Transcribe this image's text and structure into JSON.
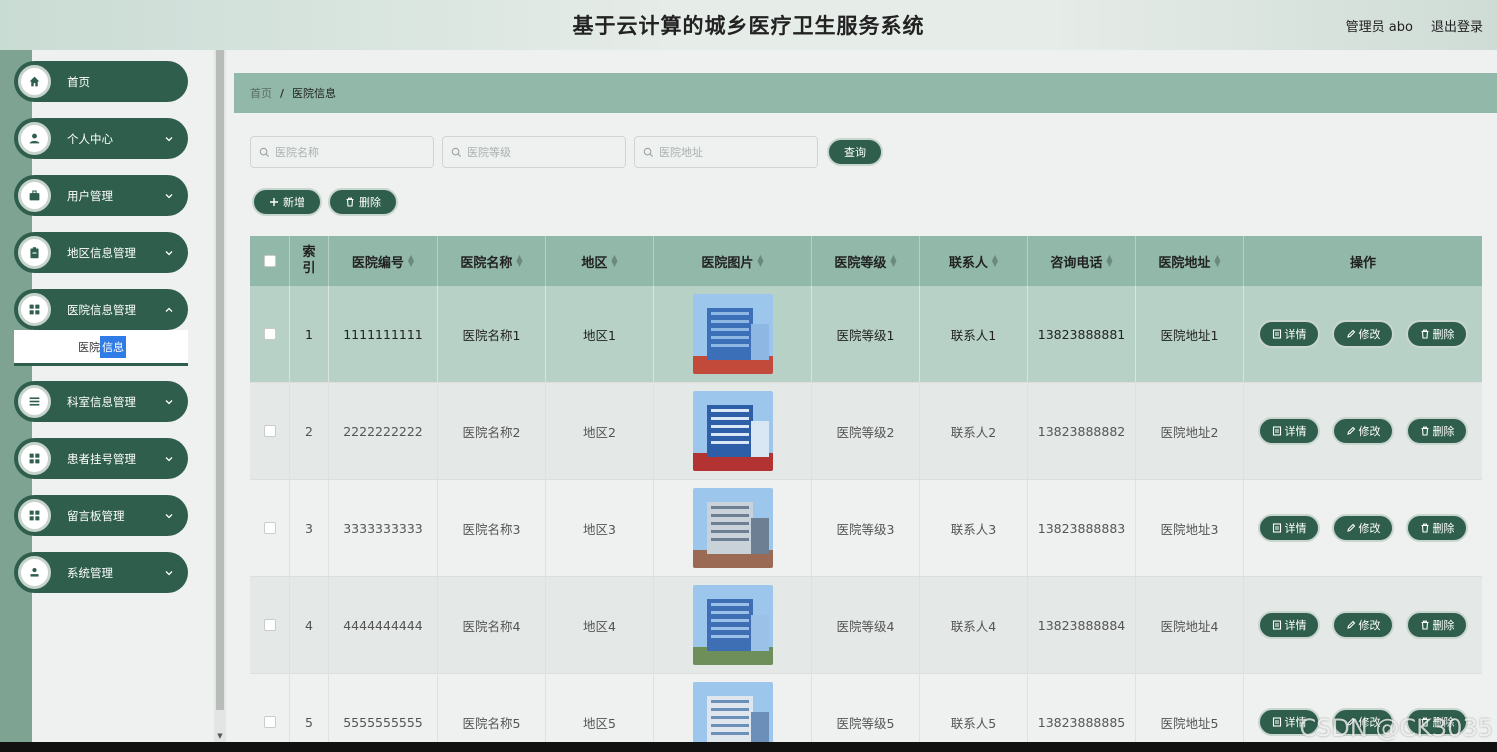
{
  "header": {
    "title": "基于云计算的城乡医疗卫生服务系统",
    "user": "管理员 abo",
    "logout": "退出登录"
  },
  "sidebar": {
    "items": [
      {
        "label": "首页",
        "icon": "home-icon",
        "chevron": false
      },
      {
        "label": "个人中心",
        "icon": "user-icon",
        "chevron": true
      },
      {
        "label": "用户管理",
        "icon": "briefcase-icon",
        "chevron": true
      },
      {
        "label": "地区信息管理",
        "icon": "clipboard-icon",
        "chevron": true
      },
      {
        "label": "医院信息管理",
        "icon": "grid-icon",
        "chevron": true
      },
      {
        "label": "科室信息管理",
        "icon": "list-icon",
        "chevron": true
      },
      {
        "label": "患者挂号管理",
        "icon": "grid-icon",
        "chevron": true
      },
      {
        "label": "留言板管理",
        "icon": "grid-icon",
        "chevron": true
      },
      {
        "label": "系统管理",
        "icon": "person-icon",
        "chevron": true
      }
    ],
    "sub_item": {
      "part1": "医院",
      "part2": "信息"
    }
  },
  "breadcrumb": {
    "home": "首页",
    "sep": "/",
    "current": "医院信息"
  },
  "search": {
    "name_placeholder": "医院名称",
    "level_placeholder": "医院等级",
    "address_placeholder": "医院地址",
    "query_label": "查询"
  },
  "actions": {
    "add_label": "新增",
    "delete_label": "删除"
  },
  "table": {
    "headers": {
      "index": "索引",
      "code": "医院编号",
      "name": "医院名称",
      "region": "地区",
      "image": "医院图片",
      "level": "医院等级",
      "contact": "联系人",
      "phone": "咨询电话",
      "address": "医院地址",
      "ops": "操作"
    },
    "rows": [
      {
        "index": "1",
        "code": "1111111111",
        "name": "医院名称1",
        "region": "地区1",
        "level": "医院等级1",
        "contact": "联系人1",
        "phone": "13823888881",
        "address": "医院地址1"
      },
      {
        "index": "2",
        "code": "2222222222",
        "name": "医院名称2",
        "region": "地区2",
        "level": "医院等级2",
        "contact": "联系人2",
        "phone": "13823888882",
        "address": "医院地址2"
      },
      {
        "index": "3",
        "code": "3333333333",
        "name": "医院名称3",
        "region": "地区3",
        "level": "医院等级3",
        "contact": "联系人3",
        "phone": "13823888883",
        "address": "医院地址3"
      },
      {
        "index": "4",
        "code": "4444444444",
        "name": "医院名称4",
        "region": "地区4",
        "level": "医院等级4",
        "contact": "联系人4",
        "phone": "13823888884",
        "address": "医院地址4"
      },
      {
        "index": "5",
        "code": "5555555555",
        "name": "医院名称5",
        "region": "地区5",
        "level": "医院等级5",
        "contact": "联系人5",
        "phone": "13823888885",
        "address": "医院地址5"
      }
    ],
    "op_labels": {
      "detail": "详情",
      "edit": "修改",
      "delete": "删除"
    }
  },
  "watermark": "CSDN @CK3035",
  "colors": {
    "primary": "#2f5e4c",
    "header_bar": "#91b8a8",
    "selected_row": "#b7d1c6"
  }
}
